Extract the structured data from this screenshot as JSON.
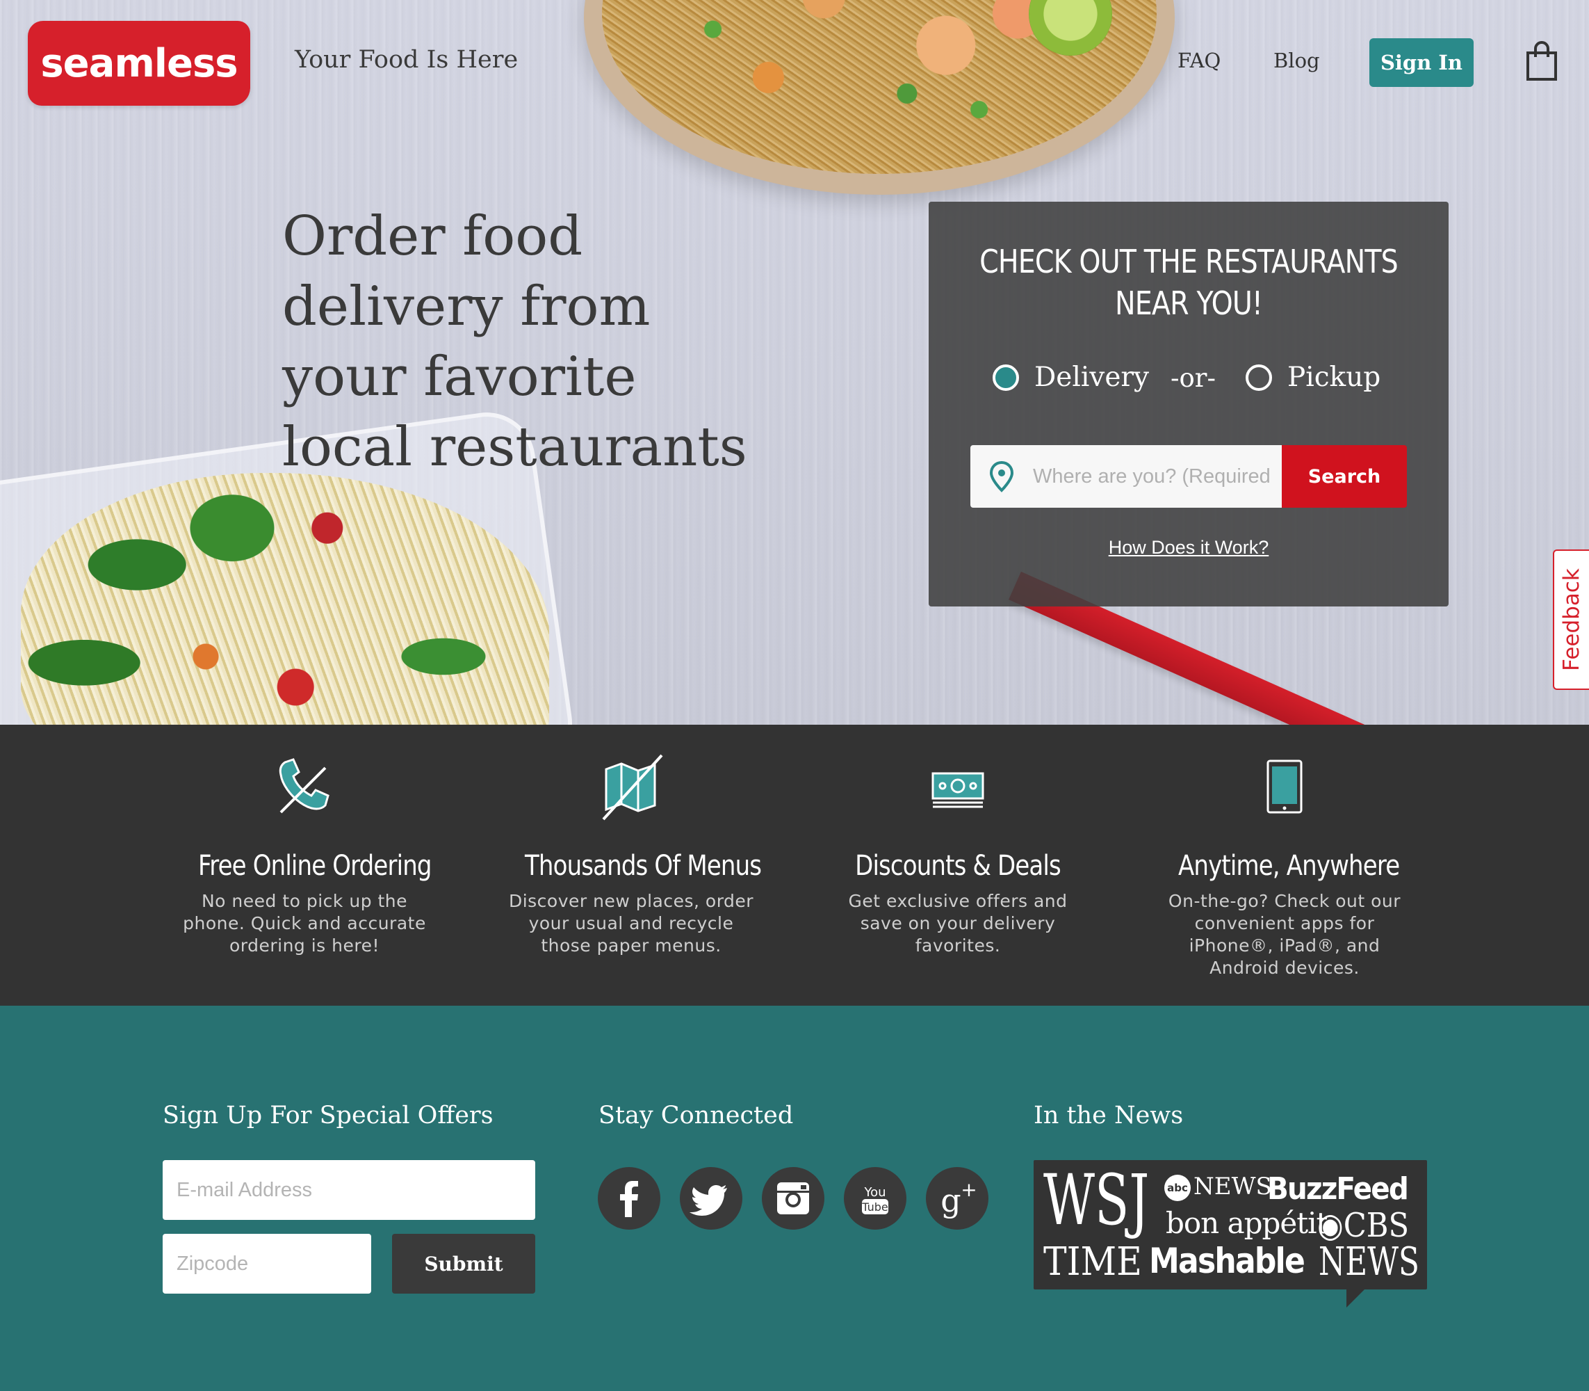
{
  "header": {
    "logo_text": "seamless",
    "tagline": "Your Food Is Here",
    "nav": {
      "faq": "FAQ",
      "blog": "Blog",
      "sign_in": "Sign In"
    },
    "cart_icon": "shopping-bag-icon"
  },
  "hero": {
    "headline": "Order food delivery from your favorite local restaurants"
  },
  "search_panel": {
    "title_line1": "CHECK OUT THE RESTAURANTS",
    "title_line2": "NEAR YOU!",
    "option_delivery": "Delivery",
    "option_separator": "-or-",
    "option_pickup": "Pickup",
    "selected_option": "Delivery",
    "input_placeholder": "Where are you? (Required)",
    "input_value": "",
    "search_button": "Search",
    "how_link": "How Does it Work?"
  },
  "feedback_tab": "Feedback",
  "features": [
    {
      "icon": "phone-icon",
      "title": "Free Online Ordering",
      "text": "No need to pick up the phone. Quick and accurate ordering is here!"
    },
    {
      "icon": "map-icon",
      "title": "Thousands Of Menus",
      "text": "Discover new places, order your usual and recycle those paper menus."
    },
    {
      "icon": "money-icon",
      "title": "Discounts & Deals",
      "text": "Get exclusive offers and save on your delivery favorites."
    },
    {
      "icon": "tablet-icon",
      "title": "Anytime, Anywhere",
      "text": "On-the-go? Check out our convenient apps for iPhone®, iPad®, and Android devices."
    }
  ],
  "footer": {
    "signup_heading": "Sign Up For Special Offers",
    "email_placeholder": "E-mail Address",
    "zip_placeholder": "Zipcode",
    "submit_label": "Submit",
    "connected_heading": "Stay Connected",
    "social_icons": [
      "facebook-icon",
      "twitter-icon",
      "instagram-icon",
      "youtube-icon",
      "google-plus-icon"
    ],
    "news_heading": "In the News",
    "news_logos": {
      "wsj": "WSJ",
      "abc": "abc",
      "abc_news": "NEWS",
      "buzzfeed": "BuzzFeed",
      "bon_appetit": "bon appétit",
      "cbs": "CBS",
      "time": "TIME",
      "mashable": "Mashable",
      "cbs_news": "NEWS"
    }
  },
  "colors": {
    "brand_red": "#d6202b",
    "teal": "#2a8a8a",
    "footer_teal": "#287272",
    "dark_band": "#333333"
  }
}
